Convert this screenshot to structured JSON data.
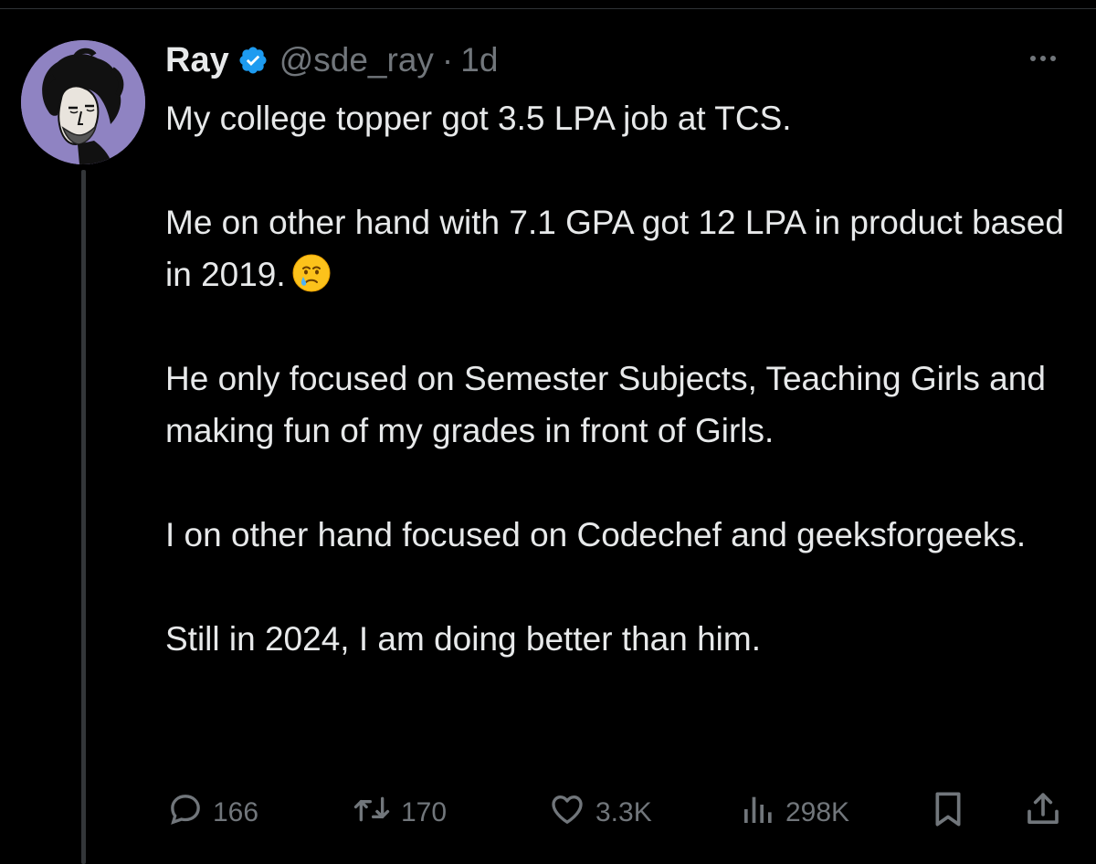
{
  "tweet": {
    "author": {
      "display_name": "Ray",
      "handle": "@sde_ray",
      "verified": true
    },
    "separator": "·",
    "time": "1d",
    "paragraphs": [
      "My college topper got 3.5 LPA job at TCS.",
      "Me on other hand with 7.1 GPA got 12 LPA in product based in 2019.",
      "He only focused on Semester Subjects, Teaching Girls and making fun of my grades in front of Girls.",
      "I on other hand focused on Codechef and geeksforgeeks.",
      "Still in 2024, I am doing better than him."
    ],
    "emoji": "face-holding-back-tears"
  },
  "actions": {
    "replies": "166",
    "reposts": "170",
    "likes": "3.3K",
    "views": "298K"
  },
  "icons": {
    "verified": "verified-badge-icon",
    "more": "more-icon",
    "reply": "reply-icon",
    "repost": "repost-icon",
    "like": "like-icon",
    "views": "views-icon",
    "bookmark": "bookmark-icon",
    "share": "share-icon"
  },
  "colors": {
    "background": "#000000",
    "text_primary": "#e7e9ea",
    "text_secondary": "#71767b",
    "verified_blue": "#1d9bf0",
    "avatar_bg": "#8f83c2"
  }
}
